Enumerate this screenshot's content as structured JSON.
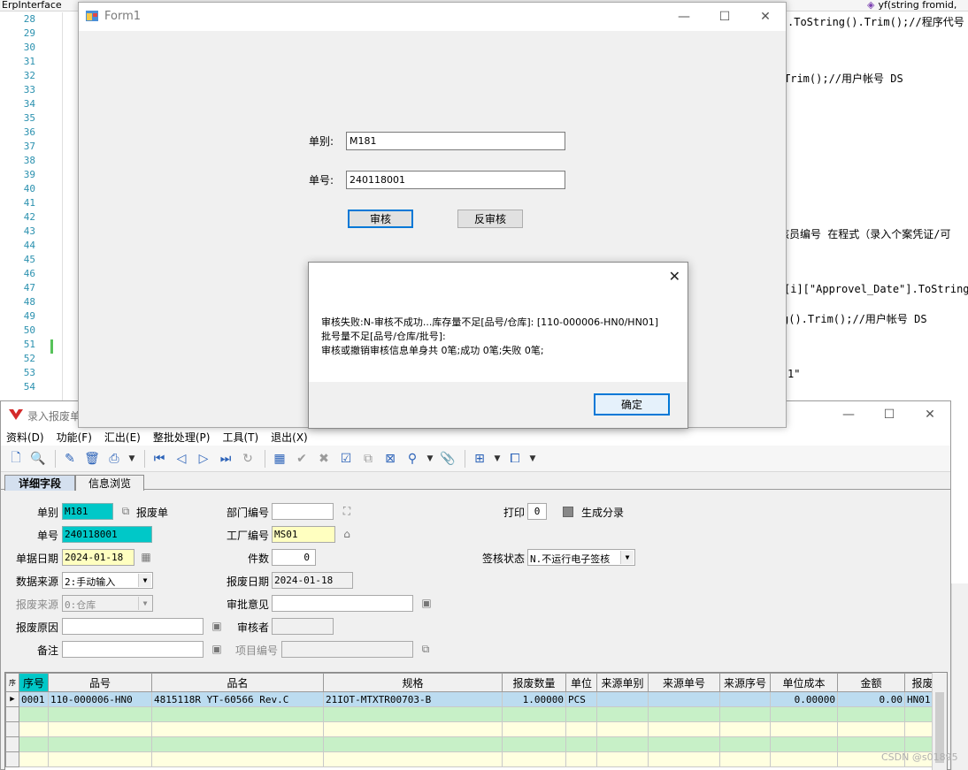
{
  "ide": {
    "project": "ErpInterface",
    "member": "yf(string fromid,",
    "line_numbers": [
      "28",
      "29",
      "30",
      "31",
      "32",
      "33",
      "34",
      "35",
      "36",
      "37",
      "38",
      "39",
      "40",
      "41",
      "42",
      "43",
      "44",
      "45",
      "46",
      "47",
      "48",
      "49",
      "50",
      "51",
      "52",
      "53",
      "54"
    ],
    "code_fragments": [
      ".ToString().Trim();//程序代号",
      "Trim();//用户帐号 DS",
      "核员编号 在程式（录入个案凭证/可",
      "[i][\"Approvel_Date\"].ToString(",
      "g().Trim();//用户帐号 DS",
      "1\""
    ]
  },
  "form1": {
    "title": "Form1",
    "label_doctype": "单别:",
    "value_doctype": "M181",
    "label_docno": "单号:",
    "value_docno": "240118001",
    "btn_approve": "审核",
    "btn_unapprove": "反审核"
  },
  "msgbox": {
    "lines": [
      "审核失败:N-审核不成功...库存量不足[品号/仓库]: [110-000006-HN0/HN01]",
      "批号量不足[品号/仓库/批号]:",
      "审核或撤销审核信息单身共  0笔;成功  0笔;失败  0笔;"
    ],
    "ok": "确定"
  },
  "erp": {
    "title": "录入报废单",
    "menu": [
      "资料(D)",
      "功能(F)",
      "汇出(E)",
      "整批处理(P)",
      "工具(T)",
      "退出(X)"
    ],
    "tabs": [
      "详细字段",
      "信息浏览"
    ],
    "fields": {
      "doctype_label": "单别",
      "doctype_value": "M181",
      "doctype_name": "报废单",
      "docno_label": "单号",
      "docno_value": "240118001",
      "docdate_label": "单据日期",
      "docdate_value": "2024-01-18",
      "source_label": "数据来源",
      "source_value": "2:手动输入",
      "scrapsrc_label": "报废来源",
      "scrapsrc_value": "0:仓库",
      "reason_label": "报废原因",
      "reason_value": "",
      "remark_label": "备注",
      "remark_value": "",
      "dept_label": "部门编号",
      "dept_value": "",
      "factory_label": "工厂编号",
      "factory_value": "MS01",
      "count_label": "件数",
      "count_value": "0",
      "scrapdate_label": "报废日期",
      "scrapdate_value": "2024-01-18",
      "opinion_label": "审批意见",
      "opinion_value": "",
      "reviewer_label": "审核者",
      "reviewer_value": "",
      "project_label": "项目编号",
      "project_value": "",
      "print_label": "打印",
      "print_value": "0",
      "gen_label": "生成分录",
      "sign_label": "签核状态",
      "sign_value": "N.不运行电子签核"
    },
    "grid": {
      "rowhdr_header": "序",
      "columns": [
        "序号",
        "品号",
        "品名",
        "规格",
        "报废数量",
        "单位",
        "来源单别",
        "来源单号",
        "来源序号",
        "单位成本",
        "金额",
        "报废"
      ],
      "rows": [
        [
          "0001",
          "110-000006-HN0",
          "4815118R YT-60566 Rev.C",
          "21IOT-MTXTR00703-B",
          "1.00000",
          "PCS",
          "",
          "",
          "",
          "0.00000",
          "0.00",
          "HN01"
        ]
      ]
    }
  },
  "watermark": "CSDN @s01895"
}
